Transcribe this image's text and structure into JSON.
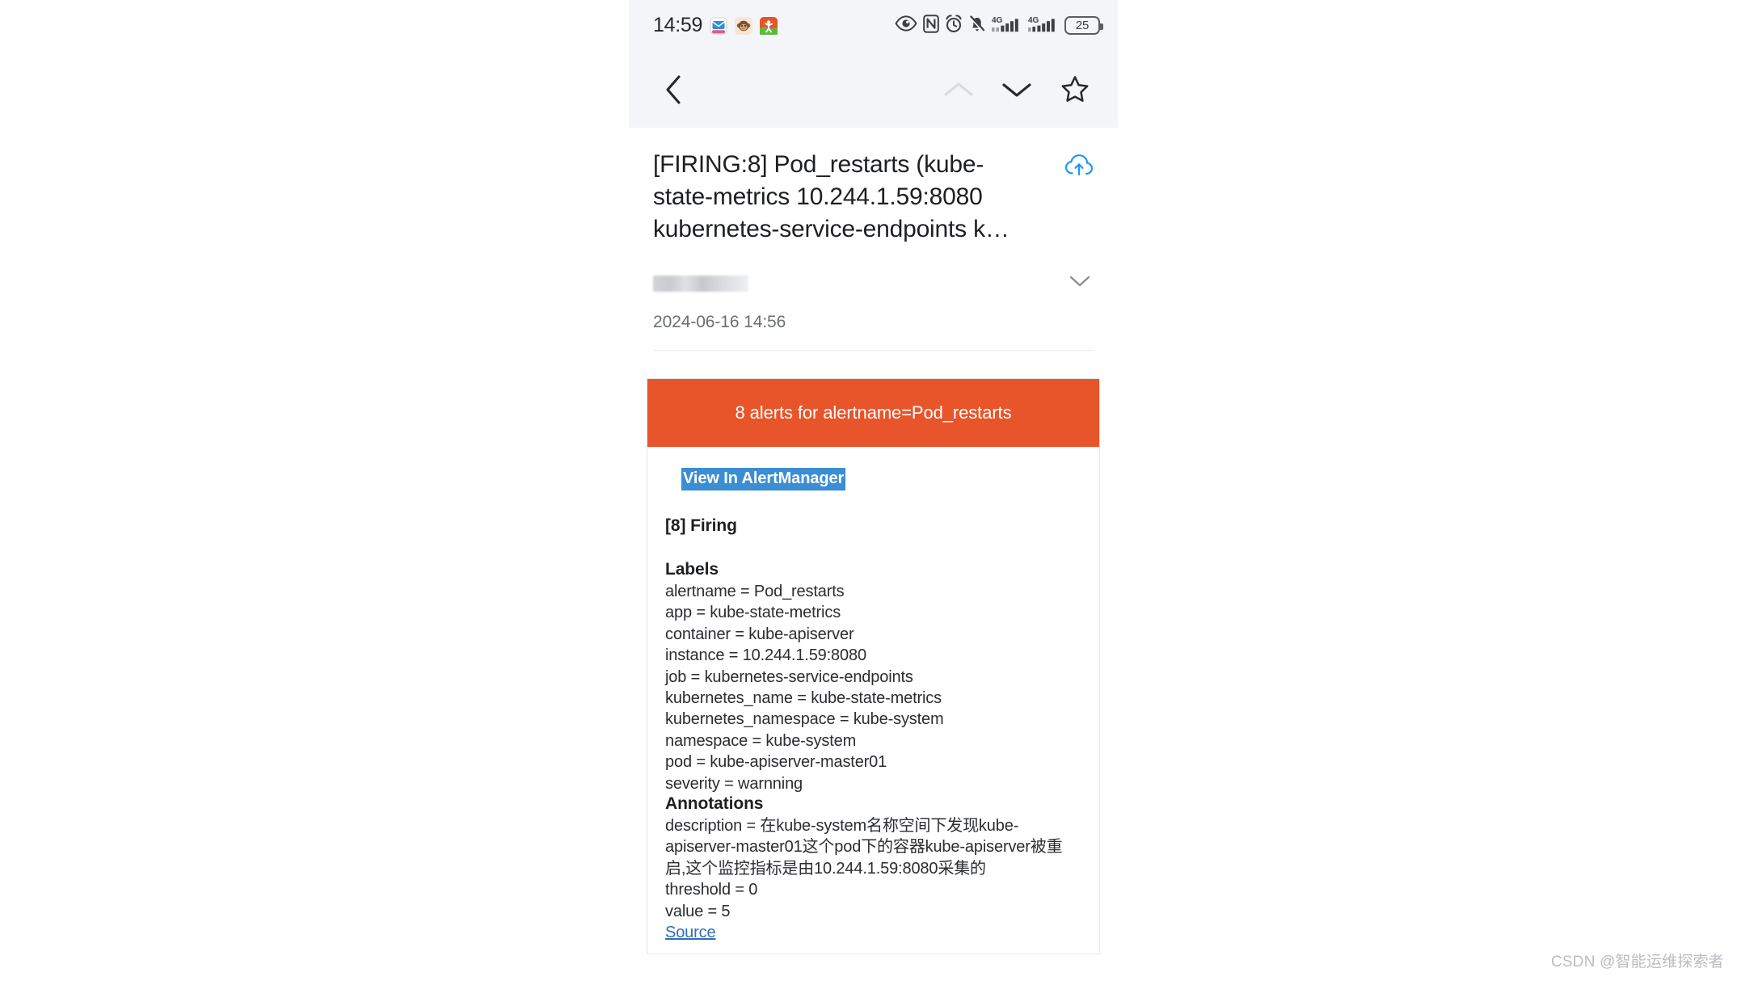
{
  "status_bar": {
    "clock": "14:59",
    "app_icons": [
      "mail-app-icon",
      "monkey-avatar-icon",
      "sports-app-icon"
    ],
    "system_icons": [
      "eye-icon",
      "nfc-icon",
      "alarm-clock-icon",
      "bell-muted-icon",
      "signal-4g-icon",
      "signal-4g-secondary-icon"
    ],
    "network_label": "4G",
    "battery_level": "25"
  },
  "toolbar": {
    "back_label": "back-chevron",
    "prev_label": "previous-message-chevron",
    "next_label": "next-message-chevron",
    "star_label": "star-outline"
  },
  "message": {
    "subject": "[FIRING:8] Pod_restarts (kube-state-metrics 10.244.1.59:8080 kubernetes-service-endpoints k…",
    "upload_icon": "cloud-upload-icon",
    "sender_redacted": "",
    "expand_icon": "chevron-down-icon",
    "date": "2024-06-16 14:56"
  },
  "alert_card": {
    "banner": "8 alerts for alertname=Pod_restarts",
    "banner_color": "#e8552b",
    "link_text": "View In AlertManager",
    "link_highlight_color": "#3b8dd4",
    "firing_header": "[8] Firing",
    "labels_title": "Labels",
    "labels": [
      "alertname = Pod_restarts",
      "app = kube-state-metrics",
      "container = kube-apiserver",
      "instance = 10.244.1.59:8080",
      "job = kubernetes-service-endpoints",
      "kubernetes_name = kube-state-metrics",
      "kubernetes_namespace = kube-system",
      "namespace = kube-system",
      "pod = kube-apiserver-master01",
      "severity = warnning"
    ],
    "annotations_title": "Annotations",
    "annotations": [
      "description = 在kube-system名称空间下发现kube-apiserver-master01这个pod下的容器kube-apiserver被重启,这个监控指标是由10.244.1.59:8080采集的",
      "threshold = 0",
      "value = 5"
    ],
    "source_link": "Source"
  },
  "watermark": "CSDN @智能运维探索者"
}
